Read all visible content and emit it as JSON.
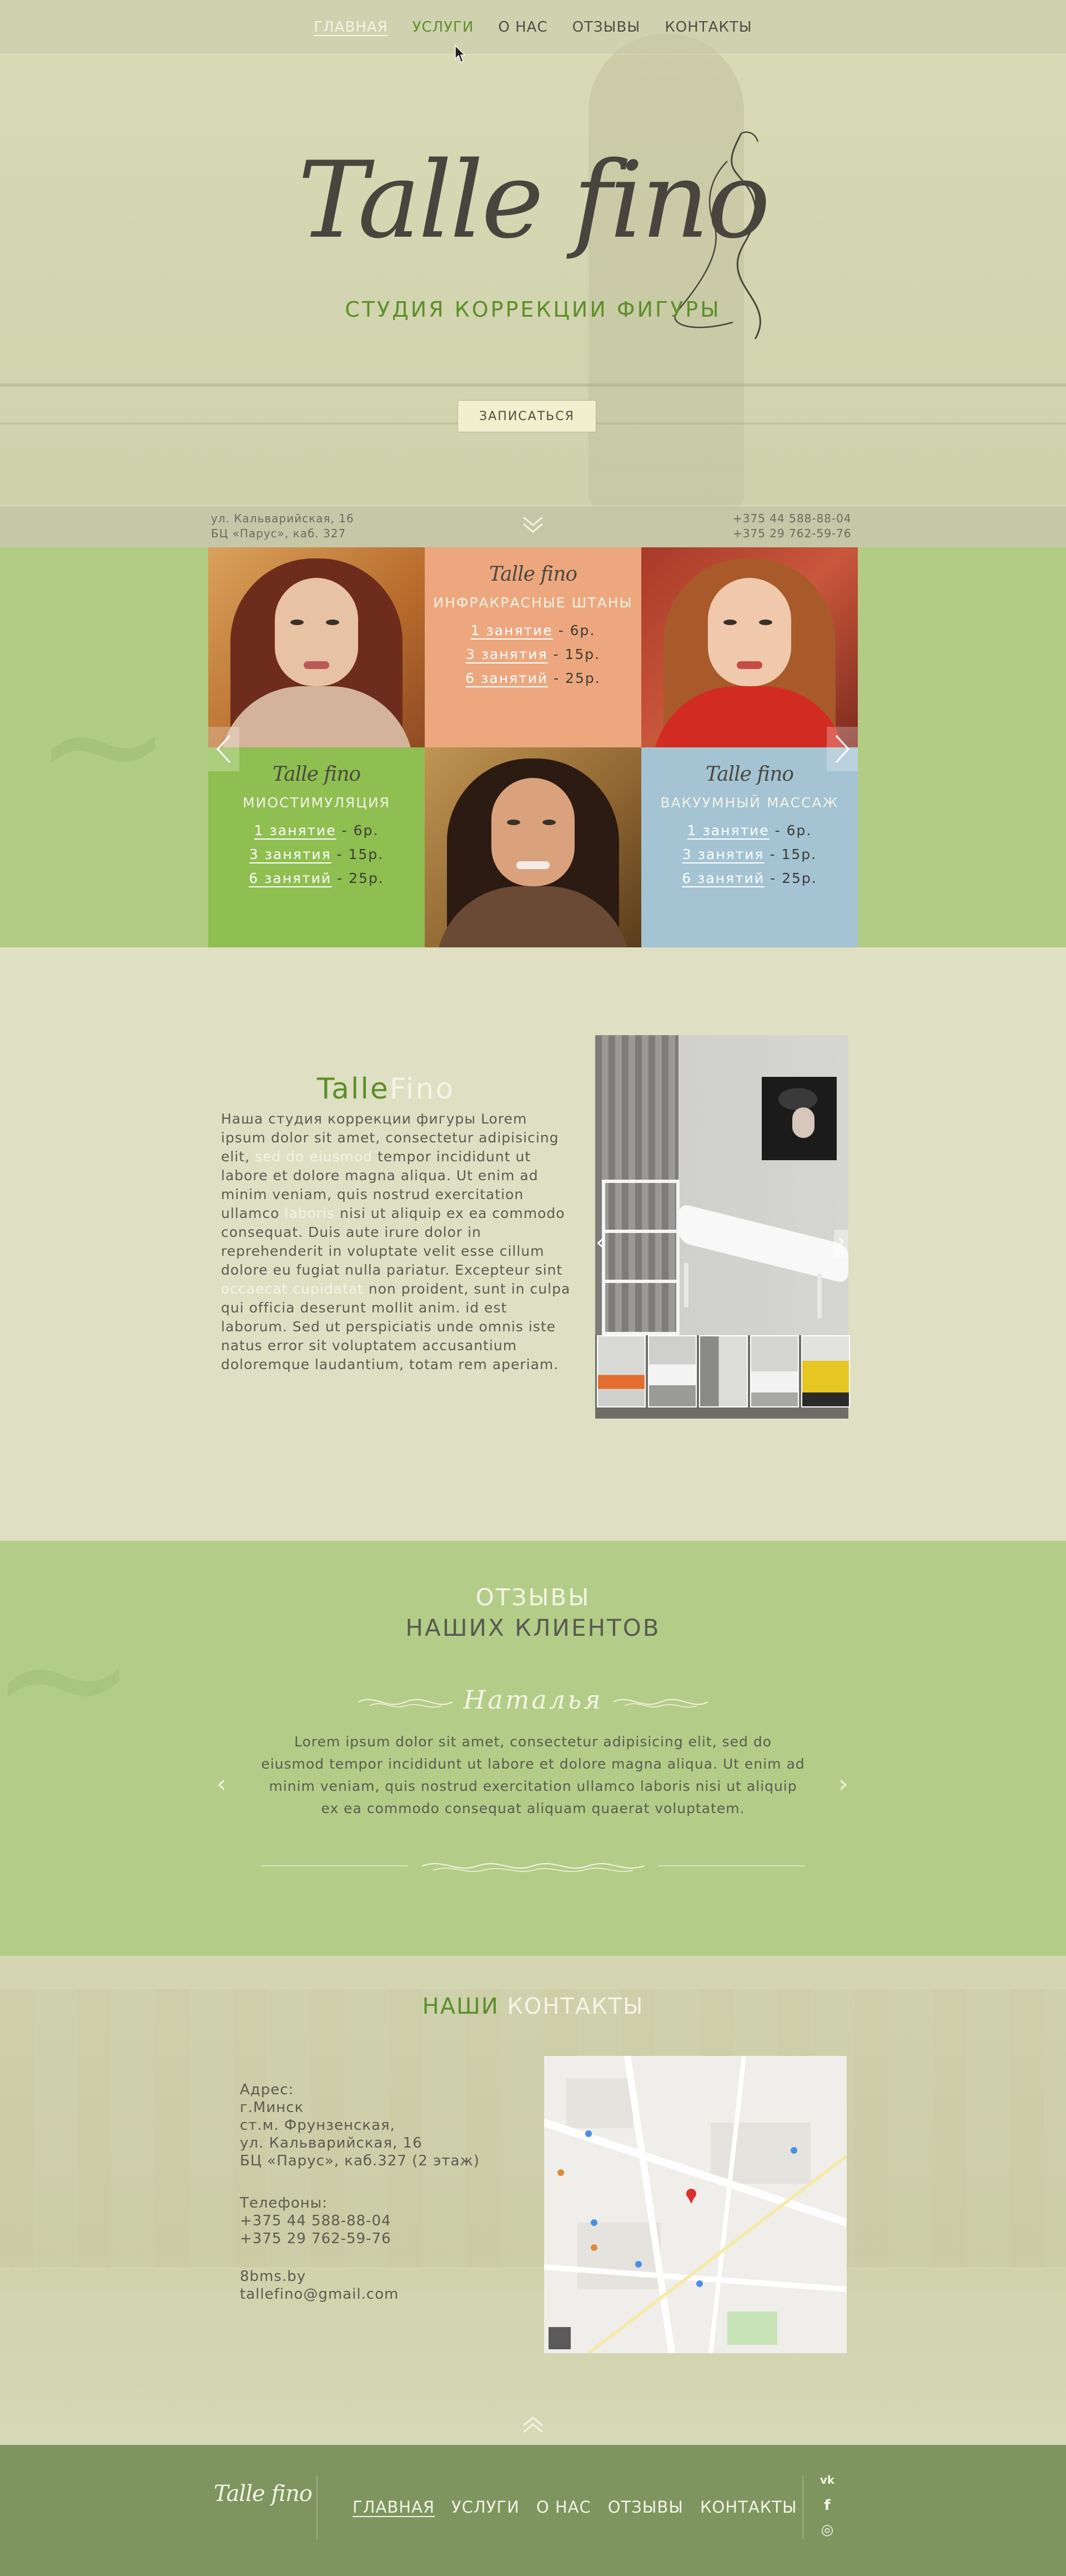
{
  "nav": {
    "items": [
      {
        "label": "ГЛАВНАЯ",
        "state": "active"
      },
      {
        "label": "УСЛУГИ",
        "state": "hover"
      },
      {
        "label": "О НАС",
        "state": ""
      },
      {
        "label": "ОТЗЫВЫ",
        "state": ""
      },
      {
        "label": "КОНТАКТЫ",
        "state": ""
      }
    ]
  },
  "hero": {
    "logo": "Talle fino",
    "tagline": "СТУДИЯ КОРРЕКЦИИ ФИГУРЫ",
    "cta_label": "ЗАПИСАТЬСЯ",
    "address_lines": [
      "ул. Кальварийская, 16",
      "БЦ «Парус», каб. 327"
    ],
    "phones": [
      "+375 44 588-88-04",
      "+375 29 762-59-76"
    ]
  },
  "services": {
    "cards": [
      {
        "logo": "Talle fino",
        "title": "ИНФРАКРАСНЫЕ ШТАНЫ",
        "color": "#eda77e",
        "prices": [
          {
            "qty": "1 занятие",
            "price": "6р."
          },
          {
            "qty": "3 занятия",
            "price": "15р."
          },
          {
            "qty": "6 занятий",
            "price": "25р."
          }
        ]
      },
      {
        "logo": "Talle fino",
        "title": "МИОСТИМУЛЯЦИЯ",
        "color": "#8fbe51",
        "prices": [
          {
            "qty": "1 занятие",
            "price": "6р."
          },
          {
            "qty": "3 занятия",
            "price": "15р."
          },
          {
            "qty": "6 занятий",
            "price": "25р."
          }
        ]
      },
      {
        "logo": "Talle fino",
        "title": "ВАКУУМНЫЙ МАССАЖ",
        "color": "#a4c3d3",
        "prices": [
          {
            "qty": "1 занятие",
            "price": "6р."
          },
          {
            "qty": "3 занятия",
            "price": "15р."
          },
          {
            "qty": "6 занятий",
            "price": "25р."
          }
        ]
      }
    ],
    "prev_icon": "chevron-left-icon",
    "next_icon": "chevron-right-icon"
  },
  "about": {
    "title_part1": "Talle",
    "title_part2": "Fino",
    "text_a": "Наша студия коррекции фигуры Lorem ipsum dolor sit amet, consectetur adipisicing elit, ",
    "text_hl1": "sed do eiusmod",
    "text_b": " tempor incididunt ut labore et dolore magna aliqua. Ut enim ad minim veniam, quis nostrud exercitation ullamco ",
    "text_hl2": "laboris",
    "text_c": " nisi ut aliquip ex ea commodo consequat. Duis aute irure dolor in reprehenderit in voluptate velit esse cillum dolore eu fugiat nulla pariatur. Excepteur sint ",
    "text_hl3": "occaecat cupidatat",
    "text_d": " non proident, sunt in culpa qui officia deserunt mollit anim. id est laborum. Sed ut perspiciatis unde omnis iste natus error sit voluptatem accusantium doloremque laudantium, totam rem aperiam."
  },
  "reviews": {
    "title_line1": "ОТЗЫВЫ",
    "title_line2": "НАШИХ КЛИЕНТОВ",
    "name": "Наталья",
    "text": "Lorem ipsum dolor sit amet, consectetur adipisicing elit, sed do eiusmod tempor incididunt ut labore et dolore magna aliqua. Ut enim ad minim veniam, quis nostrud exercitation ullamco laboris nisi ut aliquip ex ea commodo consequat aliquam quaerat voluptatem.",
    "prev_arrow": "‹",
    "next_arrow": "›"
  },
  "contacts": {
    "title_part1": "НАШИ",
    "title_part2": "КОНТАКТЫ",
    "address_label": "Адрес:",
    "address_lines": [
      "г.Минск",
      "ст.м. Фрунзенская,",
      "ул. Кальварийская, 16",
      "БЦ «Парус», каб.327 (2 этаж)"
    ],
    "phones_label": "Телефоны:",
    "phones": [
      "+375 44 588-88-04",
      "+375 29 762-59-76"
    ],
    "site": "8bms.by",
    "email": "tallefino@gmail.com"
  },
  "footer": {
    "logo": "Talle fino",
    "nav": [
      {
        "label": "ГЛАВНАЯ",
        "active": true
      },
      {
        "label": "УСЛУГИ",
        "active": false
      },
      {
        "label": "О НАС",
        "active": false
      },
      {
        "label": "ОТЗЫВЫ",
        "active": false
      },
      {
        "label": "КОНТАКТЫ",
        "active": false
      }
    ],
    "social": [
      {
        "icon": "vk-icon",
        "glyph": "vk"
      },
      {
        "icon": "facebook-icon",
        "glyph": "f"
      },
      {
        "icon": "instagram-icon",
        "glyph": "◎"
      }
    ]
  },
  "colors": {
    "accent_green": "#5d8e2a",
    "services_bg": "#b2cc83",
    "footer_bg": "#7f9560"
  }
}
